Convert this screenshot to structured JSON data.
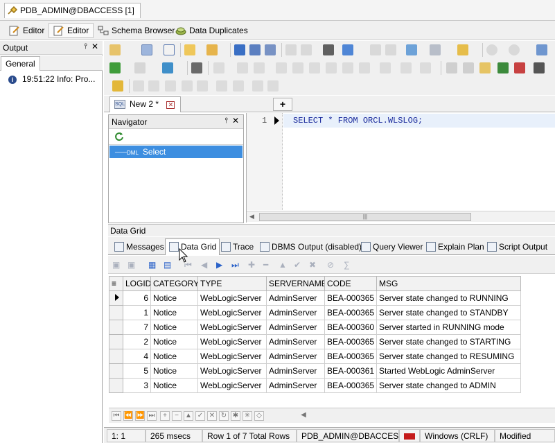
{
  "window": {
    "tab_title": "PDB_ADMIN@DBACCESS [1]"
  },
  "topbar": {
    "editor1": "Editor",
    "editor2": "Editor",
    "schema_browser": "Schema Browser",
    "data_duplicates": "Data Duplicates"
  },
  "output_panel": {
    "title": "Output",
    "tab": "General",
    "message": "19:51:22 Info: Pro..."
  },
  "editor_tabs": {
    "tab_label": "New 2 *",
    "add_label": "+"
  },
  "navigator": {
    "title": "Navigator",
    "item_tag": "DML",
    "item_label": "Select"
  },
  "editor": {
    "line_number": "1",
    "sql": "SELECT * FROM ORCL.WLSLOG;"
  },
  "results": {
    "title": "Data Grid",
    "tabs": [
      "Messages",
      "Data Grid",
      "Trace",
      "DBMS Output (disabled)",
      "Query Viewer",
      "Explain Plan",
      "Script Output"
    ],
    "columns": [
      "LOGID",
      "CATEGORY",
      "TYPE",
      "SERVERNAME",
      "CODE",
      "MSG"
    ],
    "rows": [
      [
        "6",
        "Notice",
        "WebLogicServer",
        "AdminServer",
        "BEA-000365",
        "Server state changed to RUNNING"
      ],
      [
        "1",
        "Notice",
        "WebLogicServer",
        "AdminServer",
        "BEA-000365",
        "Server state changed to STANDBY"
      ],
      [
        "7",
        "Notice",
        "WebLogicServer",
        "AdminServer",
        "BEA-000360",
        "Server started in RUNNING mode"
      ],
      [
        "2",
        "Notice",
        "WebLogicServer",
        "AdminServer",
        "BEA-000365",
        "Server state changed to STARTING"
      ],
      [
        "4",
        "Notice",
        "WebLogicServer",
        "AdminServer",
        "BEA-000365",
        "Server state changed to RESUMING"
      ],
      [
        "5",
        "Notice",
        "WebLogicServer",
        "AdminServer",
        "BEA-000361",
        "Started WebLogic AdminServer"
      ],
      [
        "3",
        "Notice",
        "WebLogicServer",
        "AdminServer",
        "BEA-000365",
        "Server state changed to ADMIN"
      ]
    ]
  },
  "status_bar": {
    "position": "1:   1",
    "time": "265 msecs",
    "rows": "Row 1 of 7 Total Rows",
    "connection": "PDB_ADMIN@DBACCESS",
    "line_endings": "Windows (CRLF)",
    "state": "Modified"
  },
  "colors": {
    "selection": "#3d8ee0",
    "sql_keyword": "#1a2a9c",
    "current_line": "#e8f0fb"
  }
}
